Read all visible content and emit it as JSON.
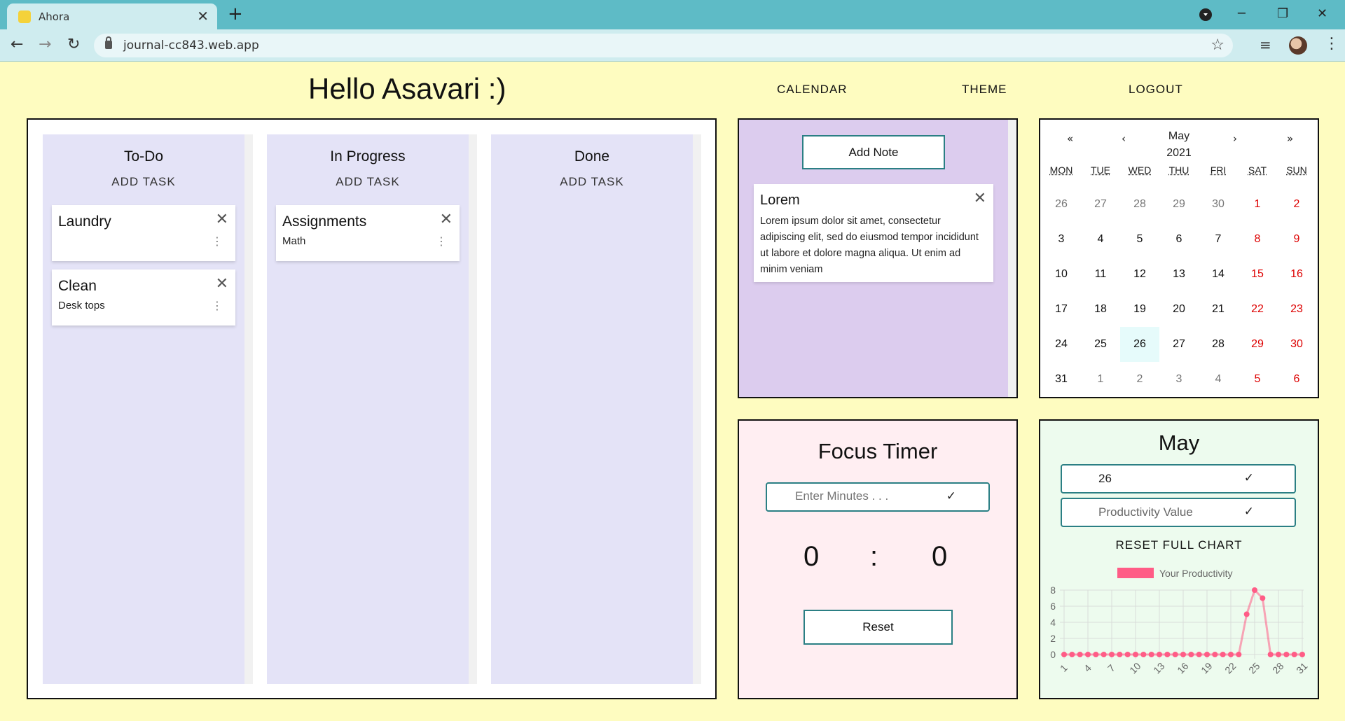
{
  "browser": {
    "tab_title": "Ahora",
    "url": "journal-cc843.web.app",
    "tab_close": "✕",
    "new_tab": "+",
    "back": "←",
    "forward": "→",
    "reload": "↻",
    "star": "☆",
    "minimize": "─",
    "maximize": "❐",
    "close": "✕",
    "menu": "⋮",
    "ext": "≡"
  },
  "header": {
    "greeting": "Hello Asavari :)",
    "nav": [
      "CALENDAR",
      "THEME",
      "LOGOUT"
    ]
  },
  "board": {
    "columns": [
      {
        "title": "To-Do",
        "add_label": "ADD TASK",
        "cards": [
          {
            "title": "Laundry",
            "subtitle": ""
          },
          {
            "title": "Clean",
            "subtitle": "Desk tops"
          }
        ]
      },
      {
        "title": "In Progress",
        "add_label": "ADD TASK",
        "cards": [
          {
            "title": "Assignments",
            "subtitle": "Math"
          }
        ]
      },
      {
        "title": "Done",
        "add_label": "ADD TASK",
        "cards": []
      }
    ],
    "close_glyph": "✕",
    "menu_glyph": "⋮"
  },
  "notes": {
    "add_label": "Add Note",
    "items": [
      {
        "title": "Lorem",
        "body": "Lorem ipsum dolor sit amet, consectetur adipiscing elit, sed do eiusmod tempor incididunt ut labore et dolore magna aliqua. Ut enim ad minim veniam"
      }
    ]
  },
  "calendar": {
    "month": "May",
    "year": "2021",
    "nav": {
      "prev_year": "«",
      "prev": "‹",
      "next": "›",
      "next_year": "»"
    },
    "weekdays": [
      "MON",
      "TUE",
      "WED",
      "THU",
      "FRI",
      "SAT",
      "SUN"
    ],
    "days": [
      "26",
      "27",
      "28",
      "29",
      "30",
      "1",
      "2",
      "3",
      "4",
      "5",
      "6",
      "7",
      "8",
      "9",
      "10",
      "11",
      "12",
      "13",
      "14",
      "15",
      "16",
      "17",
      "18",
      "19",
      "20",
      "21",
      "22",
      "23",
      "24",
      "25",
      "26",
      "27",
      "28",
      "29",
      "30",
      "31",
      "1",
      "2",
      "3",
      "4",
      "5",
      "6"
    ],
    "first_in_month": 5,
    "last_in_month": 35,
    "selected_date": "26"
  },
  "timer": {
    "title": "Focus Timer",
    "placeholder": "Enter Minutes . . .",
    "check": "✓",
    "minutes": "0",
    "separator": ":",
    "seconds": "0",
    "reset_label": "Reset"
  },
  "productivity": {
    "title": "May",
    "day_value": "26",
    "value_placeholder": "Productivity Value",
    "check": "✓",
    "reset_label": "RESET FULL CHART"
  },
  "chart_data": {
    "type": "line",
    "legend": [
      "Your Productivity"
    ],
    "series": [
      {
        "name": "Your Productivity",
        "color": "#ff5c86",
        "values": [
          0,
          0,
          0,
          0,
          0,
          0,
          0,
          0,
          0,
          0,
          0,
          0,
          0,
          0,
          0,
          0,
          0,
          0,
          0,
          0,
          0,
          0,
          0,
          5,
          8,
          7,
          0,
          0,
          0,
          0,
          0
        ]
      }
    ],
    "x": [
      1,
      2,
      3,
      4,
      5,
      6,
      7,
      8,
      9,
      10,
      11,
      12,
      13,
      14,
      15,
      16,
      17,
      18,
      19,
      20,
      21,
      22,
      23,
      24,
      25,
      26,
      27,
      28,
      29,
      30,
      31
    ],
    "xticks": [
      "1",
      "4",
      "7",
      "10",
      "13",
      "16",
      "19",
      "22",
      "25",
      "28",
      "31"
    ],
    "yticks": [
      "0",
      "2",
      "4",
      "6",
      "8"
    ],
    "ylim": [
      0,
      8
    ],
    "grid": true,
    "legend_position": "top"
  }
}
